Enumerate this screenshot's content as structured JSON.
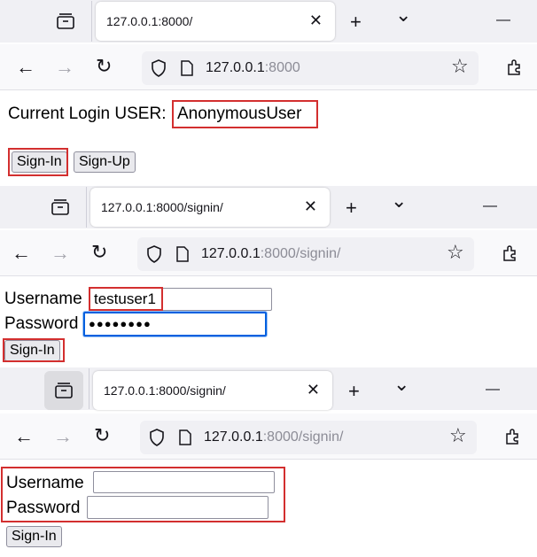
{
  "panel1": {
    "tab_title": "127.0.0.1:8000/",
    "url_host": "127.0.0.1",
    "url_path": ":8000",
    "current_login_label": "Current Login USER:",
    "current_user": "AnonymousUser",
    "signin_label": "Sign-In",
    "signup_label": "Sign-Up"
  },
  "panel2": {
    "tab_title": "127.0.0.1:8000/signin/",
    "url_host": "127.0.0.1",
    "url_path": ":8000/signin/",
    "username_label": "Username",
    "username_value": "testuser1",
    "password_label": "Password",
    "password_value": "●●●●●●●●",
    "signin_label": "Sign-In"
  },
  "panel3": {
    "tab_title": "127.0.0.1:8000/signin/",
    "url_host": "127.0.0.1",
    "url_path": ":8000/signin/",
    "username_label": "Username",
    "username_value": "",
    "password_label": "Password",
    "password_value": "",
    "signin_label": "Sign-In"
  },
  "common": {
    "tab_close_glyph": "✕",
    "new_tab_glyph": "+",
    "tab_list_glyph": "⌄",
    "minimize_glyph": "—",
    "back_glyph": "←",
    "forward_glyph": "→",
    "reload_glyph": "↻",
    "bookmark_glyph": "☆",
    "highlight_color": "#d32f2f"
  }
}
